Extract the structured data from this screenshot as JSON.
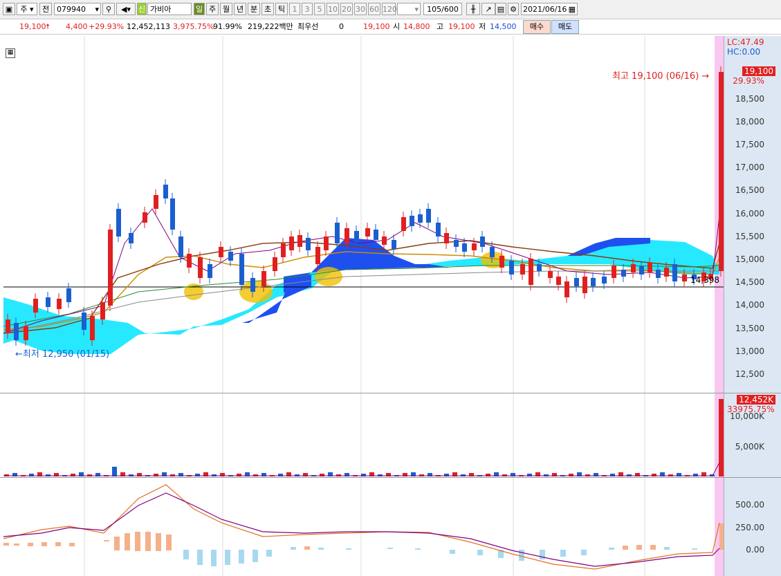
{
  "toolbar": {
    "market_mode": "주",
    "prev_label": "전",
    "code": "079940",
    "stock_name": "가비아",
    "new_badge": "신",
    "periods": [
      "일",
      "주",
      "월",
      "년",
      "분",
      "초",
      "틱"
    ],
    "active_period": "일",
    "intervals": [
      "1",
      "3",
      "5",
      "10",
      "20",
      "30",
      "60",
      "120"
    ],
    "count": "105/600",
    "date": "2021/06/16"
  },
  "quote": {
    "price": "19,100",
    "change": "4,400",
    "change_pct": "+29.93%",
    "volume": "12,452,113",
    "volume_pct": "3,975.75%",
    "turnover": "91.99%",
    "amount": "219,222백만",
    "best_bid_label": "최우선",
    "best_bid_value": "0",
    "best_ask": "19,100",
    "open_label": "시",
    "open": "14,800",
    "high_label": "고",
    "high": "19,100",
    "low_label": "저",
    "low": "14,500",
    "buy_label": "매수",
    "sell_label": "매도"
  },
  "price_panel": {
    "lc": "LC:47.49",
    "hc": "HC:0.00",
    "y_ticks": [
      "18,500",
      "18,000",
      "17,500",
      "17,000",
      "16,500",
      "16,000",
      "15,500",
      "15,000",
      "14,500",
      "14,000",
      "13,500",
      "13,000",
      "12,500"
    ],
    "last_price_tag": "19,100",
    "last_pct_tag": "29.93%",
    "high_note": "최고 19,100 (06/16) →",
    "low_note": "←최저 12,950 (01/15)",
    "hline_value": "14,398",
    "colors": {
      "up": "#e02020",
      "down": "#1a5fd0",
      "cloud_up": "#00e5ff",
      "cloud_down": "#1e50f0"
    }
  },
  "volume_panel": {
    "tag_value": "12,452K",
    "tag_pct": "33975.75%",
    "y_ticks": [
      "10,000K",
      "5,000K"
    ]
  },
  "macd_panel": {
    "y_ticks": [
      "500.00",
      "250.00",
      "0.00"
    ]
  }
}
